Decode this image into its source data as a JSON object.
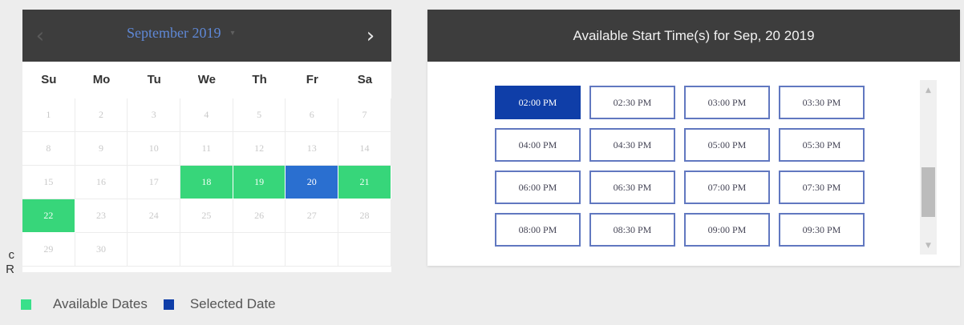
{
  "edge_text": "c\nR",
  "calendar": {
    "prev_icon": "‹",
    "next_icon": "›",
    "month_title": "September 2019",
    "dropdown_icon": "▾",
    "weekdays": [
      "Su",
      "Mo",
      "Tu",
      "We",
      "Th",
      "Fr",
      "Sa"
    ],
    "days": [
      {
        "label": "1",
        "state": "disabled"
      },
      {
        "label": "2",
        "state": "disabled"
      },
      {
        "label": "3",
        "state": "disabled"
      },
      {
        "label": "4",
        "state": "disabled"
      },
      {
        "label": "5",
        "state": "disabled"
      },
      {
        "label": "6",
        "state": "disabled"
      },
      {
        "label": "7",
        "state": "disabled"
      },
      {
        "label": "8",
        "state": "disabled"
      },
      {
        "label": "9",
        "state": "disabled"
      },
      {
        "label": "10",
        "state": "disabled"
      },
      {
        "label": "11",
        "state": "disabled"
      },
      {
        "label": "12",
        "state": "disabled"
      },
      {
        "label": "13",
        "state": "disabled"
      },
      {
        "label": "14",
        "state": "disabled"
      },
      {
        "label": "15",
        "state": "disabled"
      },
      {
        "label": "16",
        "state": "disabled"
      },
      {
        "label": "17",
        "state": "disabled"
      },
      {
        "label": "18",
        "state": "available"
      },
      {
        "label": "19",
        "state": "available"
      },
      {
        "label": "20",
        "state": "selected"
      },
      {
        "label": "21",
        "state": "available"
      },
      {
        "label": "22",
        "state": "available"
      },
      {
        "label": "23",
        "state": "disabled"
      },
      {
        "label": "24",
        "state": "disabled"
      },
      {
        "label": "25",
        "state": "disabled"
      },
      {
        "label": "26",
        "state": "disabled"
      },
      {
        "label": "27",
        "state": "disabled"
      },
      {
        "label": "28",
        "state": "disabled"
      },
      {
        "label": "29",
        "state": "disabled"
      },
      {
        "label": "30",
        "state": "disabled"
      },
      {
        "label": "",
        "state": "blank"
      },
      {
        "label": "",
        "state": "blank"
      },
      {
        "label": "",
        "state": "blank"
      },
      {
        "label": "",
        "state": "blank"
      },
      {
        "label": "",
        "state": "blank"
      }
    ]
  },
  "legend": {
    "available_label": "Available Dates",
    "selected_label": "Selected Date"
  },
  "times": {
    "title": "Available Start Time(s) for Sep, 20 2019",
    "slots": [
      {
        "label": "02:00 PM",
        "selected": true
      },
      {
        "label": "02:30 PM",
        "selected": false
      },
      {
        "label": "03:00 PM",
        "selected": false
      },
      {
        "label": "03:30 PM",
        "selected": false
      },
      {
        "label": "04:00 PM",
        "selected": false
      },
      {
        "label": "04:30 PM",
        "selected": false
      },
      {
        "label": "05:00 PM",
        "selected": false
      },
      {
        "label": "05:30 PM",
        "selected": false
      },
      {
        "label": "06:00 PM",
        "selected": false
      },
      {
        "label": "06:30 PM",
        "selected": false
      },
      {
        "label": "07:00 PM",
        "selected": false
      },
      {
        "label": "07:30 PM",
        "selected": false
      },
      {
        "label": "08:00 PM",
        "selected": false
      },
      {
        "label": "08:30 PM",
        "selected": false
      },
      {
        "label": "09:00 PM",
        "selected": false
      },
      {
        "label": "09:30 PM",
        "selected": false
      }
    ],
    "scroll_up_icon": "▲",
    "scroll_down_icon": "▼",
    "scroll_position": 0.75
  },
  "colors": {
    "header_bg": "#3d3d3d",
    "available_green": "#37d67a",
    "selected_date_blue": "#2a6fd0",
    "selected_slot_navy": "#0f3ea8",
    "slot_border": "#6178c0"
  }
}
